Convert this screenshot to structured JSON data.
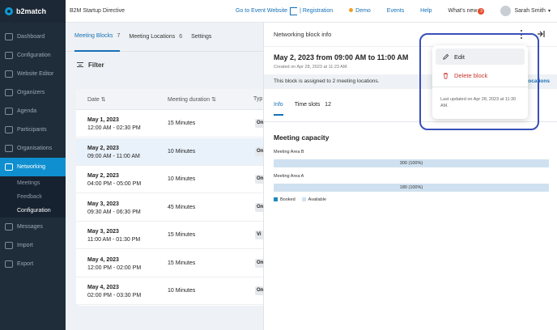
{
  "app": {
    "brand": "b2match",
    "event_name": "B2M Startup Directive"
  },
  "topbar": {
    "go_to_event": "Go to Event Website",
    "registration": "| Registration",
    "demo": "Demo",
    "events": "Events",
    "help": "Help",
    "whats_new": "What's new",
    "whats_new_count": "3",
    "user_name": "Sarah Smith"
  },
  "sidebar": {
    "items": [
      {
        "label": "Dashboard"
      },
      {
        "label": "Configuration"
      },
      {
        "label": "Website Editor"
      },
      {
        "label": "Organizers"
      },
      {
        "label": "Agenda"
      },
      {
        "label": "Participants"
      },
      {
        "label": "Organisations"
      },
      {
        "label": "Networking"
      },
      {
        "label": "Messages"
      },
      {
        "label": "Import"
      },
      {
        "label": "Export"
      }
    ],
    "subitems": [
      {
        "label": "Meetings"
      },
      {
        "label": "Feedback"
      },
      {
        "label": "Configuration"
      }
    ]
  },
  "main": {
    "tabs": [
      {
        "label": "Meeting Blocks",
        "count": "7"
      },
      {
        "label": "Meeting Locations",
        "count": "6"
      },
      {
        "label": "Settings",
        "count": ""
      }
    ],
    "filter_label": "Filter",
    "columns": {
      "date": "Date",
      "duration": "Meeting duration",
      "type": "Typ"
    },
    "rows": [
      {
        "date": "May 1, 2023",
        "time": "12:00 AM - 02:30 PM",
        "duration": "15 Minutes",
        "type": "On"
      },
      {
        "date": "May 2, 2023",
        "time": "09:00 AM - 11:00 AM",
        "duration": "10 Minutes",
        "type": "On"
      },
      {
        "date": "May 2, 2023",
        "time": "04:00 PM - 05:00 PM",
        "duration": "10 Minutes",
        "type": "On"
      },
      {
        "date": "May 3, 2023",
        "time": "09:30 AM - 06:30 PM",
        "duration": "45 Minutes",
        "type": "On"
      },
      {
        "date": "May 3, 2023",
        "time": "11:00 AM - 01:30 PM",
        "duration": "15 Minutes",
        "type": "Vi"
      },
      {
        "date": "May 4, 2023",
        "time": "12:00 PM - 02:00 PM",
        "duration": "15 Minutes",
        "type": "On"
      },
      {
        "date": "May 4, 2023",
        "time": "02:00 PM - 03:30 PM",
        "duration": "10 Minutes",
        "type": "On"
      }
    ]
  },
  "panel": {
    "header": "Networking block info",
    "title": "May 2, 2023 from 09:00 AM to 11:00 AM",
    "created": "Created on Apr 28, 2023 at 11:23 AM.",
    "assigned": "This block is assigned to 2 meeting locations.",
    "assigned_link": "ocations",
    "tabs": [
      {
        "label": "Info"
      },
      {
        "label": "Time slots",
        "count": "12"
      }
    ],
    "capacity_title": "Meeting capacity",
    "areas": [
      {
        "name": "Meeting Area B",
        "value": "300 (100%)",
        "fill": 1.0
      },
      {
        "name": "Meeting Area A",
        "value": "180 (100%)",
        "fill": 1.0
      }
    ],
    "legend": [
      {
        "label": "Booked",
        "color": "#1b8bbf"
      },
      {
        "label": "Available",
        "color": "#cfe1f0"
      }
    ]
  },
  "menu": {
    "edit": "Edit",
    "delete": "Delete block",
    "updated": "Last updated on Apr 28, 2023 at 11:30 AM."
  },
  "colors": {
    "accent": "#1570b6",
    "sidebar": "#1f2d3b",
    "danger": "#c8342a",
    "highlight": "#3950b8"
  }
}
